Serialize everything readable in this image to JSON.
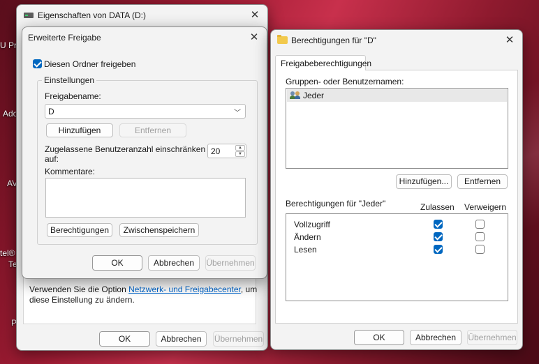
{
  "desktop": {
    "labels": [
      "U Pri",
      "Ado",
      "AV",
      "tel®",
      "Te",
      "P"
    ]
  },
  "props_window": {
    "title": "Eigenschaften von DATA (D:)",
    "info_text_pre": "Verwenden Sie die Option ",
    "info_link": "Netzwerk- und Freigabecenter",
    "info_text_post": ", um",
    "info_text_line2": "diese Einstellung zu ändern.",
    "ok": "OK",
    "cancel": "Abbrechen",
    "apply": "Übernehmen"
  },
  "advanced_share": {
    "title": "Erweiterte Freigabe",
    "share_folder_label": "Diesen Ordner freigeben",
    "share_folder_checked": true,
    "settings_group": "Einstellungen",
    "share_name_label": "Freigabename:",
    "share_name_value": "D",
    "add_button": "Hinzufügen",
    "remove_button": "Entfernen",
    "user_limit_label_1": "Zugelassene Benutzeranzahl einschränken",
    "user_limit_label_2": "auf:",
    "user_limit_value": "20",
    "comments_label": "Kommentare:",
    "comments_value": "",
    "permissions_button": "Berechtigungen",
    "caching_button": "Zwischenspeichern",
    "ok": "OK",
    "cancel": "Abbrechen",
    "apply": "Übernehmen"
  },
  "permissions": {
    "title": "Berechtigungen für \"D\"",
    "tab": "Freigabeberechtigungen",
    "groups_label": "Gruppen- oder Benutzernamen:",
    "users": [
      "Jeder"
    ],
    "add_button": "Hinzufügen...",
    "remove_button": "Entfernen",
    "perm_for_label": "Berechtigungen für \"Jeder\"",
    "allow_header": "Zulassen",
    "deny_header": "Verweigern",
    "rows": [
      {
        "name": "Vollzugriff",
        "allow": true,
        "deny": false
      },
      {
        "name": "Ändern",
        "allow": true,
        "deny": false
      },
      {
        "name": "Lesen",
        "allow": true,
        "deny": false
      }
    ],
    "ok": "OK",
    "cancel": "Abbrechen",
    "apply": "Übernehmen"
  }
}
